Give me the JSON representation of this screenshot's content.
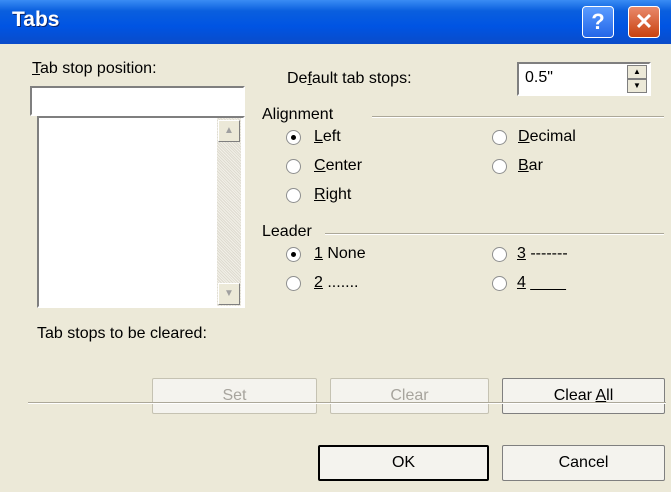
{
  "window": {
    "title": "Tabs",
    "help": "?",
    "close": "✕"
  },
  "tab_stop_position": {
    "label_u": "T",
    "label_rest": "ab stop position:",
    "value": ""
  },
  "default_tab_stops": {
    "label_a": "De",
    "label_u": "f",
    "label_b": "ault tab stops:",
    "value": "0.5\""
  },
  "alignment": {
    "label": "Alignment",
    "options": [
      {
        "u": "L",
        "rest": "eft",
        "checked": true
      },
      {
        "u": "C",
        "rest": "enter",
        "checked": false
      },
      {
        "u": "R",
        "rest": "ight",
        "checked": false
      },
      {
        "u": "D",
        "rest": "ecimal",
        "checked": false
      },
      {
        "u": "B",
        "rest": "ar",
        "checked": false
      }
    ]
  },
  "leader": {
    "label": "Leader",
    "options": [
      {
        "u": "1",
        "rest": " None",
        "checked": true
      },
      {
        "u": "2",
        "rest": " .......",
        "checked": false
      },
      {
        "u": "3",
        "rest": " -------",
        "checked": false
      },
      {
        "u": "4",
        "rest": " ____",
        "checked": false
      }
    ]
  },
  "cleared_label": "Tab stops to be cleared:",
  "buttons": {
    "set": "Set",
    "clear": "Clear",
    "clear_all_a": "Clear ",
    "clear_all_u": "A",
    "clear_all_b": "ll",
    "ok": "OK",
    "cancel": "Cancel"
  }
}
